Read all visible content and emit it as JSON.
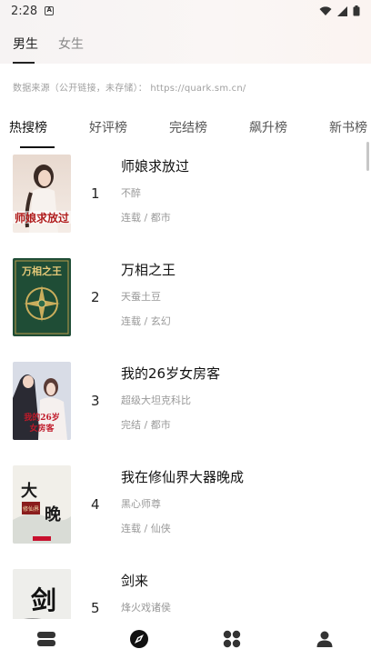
{
  "status": {
    "time": "2:28"
  },
  "gender_tabs": [
    {
      "label": "男生",
      "active": true
    },
    {
      "label": "女生",
      "active": false
    }
  ],
  "source_note": "数据来源（公开链接，未存储）：  https://quark.sm.cn/",
  "rank_tabs": [
    {
      "label": "热搜榜",
      "active": true
    },
    {
      "label": "好评榜",
      "active": false
    },
    {
      "label": "完结榜",
      "active": false
    },
    {
      "label": "飙升榜",
      "active": false
    },
    {
      "label": "新书榜",
      "active": false
    }
  ],
  "books": [
    {
      "rank": "1",
      "title": "师娘求放过",
      "author": "不醉",
      "meta": "连载 / 都市",
      "cover_text": "师娘求放过"
    },
    {
      "rank": "2",
      "title": "万相之王",
      "author": "天蚕土豆",
      "meta": "连载 / 玄幻",
      "cover_text": "万相之王"
    },
    {
      "rank": "3",
      "title": "我的26岁女房客",
      "author": "超级大坦克科比",
      "meta": "完结 / 都市",
      "cover_text": "我的26岁女房客"
    },
    {
      "rank": "4",
      "title": "我在修仙界大器晚成",
      "author": "黑心师尊",
      "meta": "连载 / 仙侠",
      "cover_text": "大器晚成"
    },
    {
      "rank": "5",
      "title": "剑来",
      "author": "烽火戏诸侯",
      "meta": "",
      "cover_text": "剑"
    }
  ],
  "icons": {
    "nav": [
      "bookshelf-icon",
      "discover-icon",
      "category-icon",
      "profile-icon"
    ]
  }
}
